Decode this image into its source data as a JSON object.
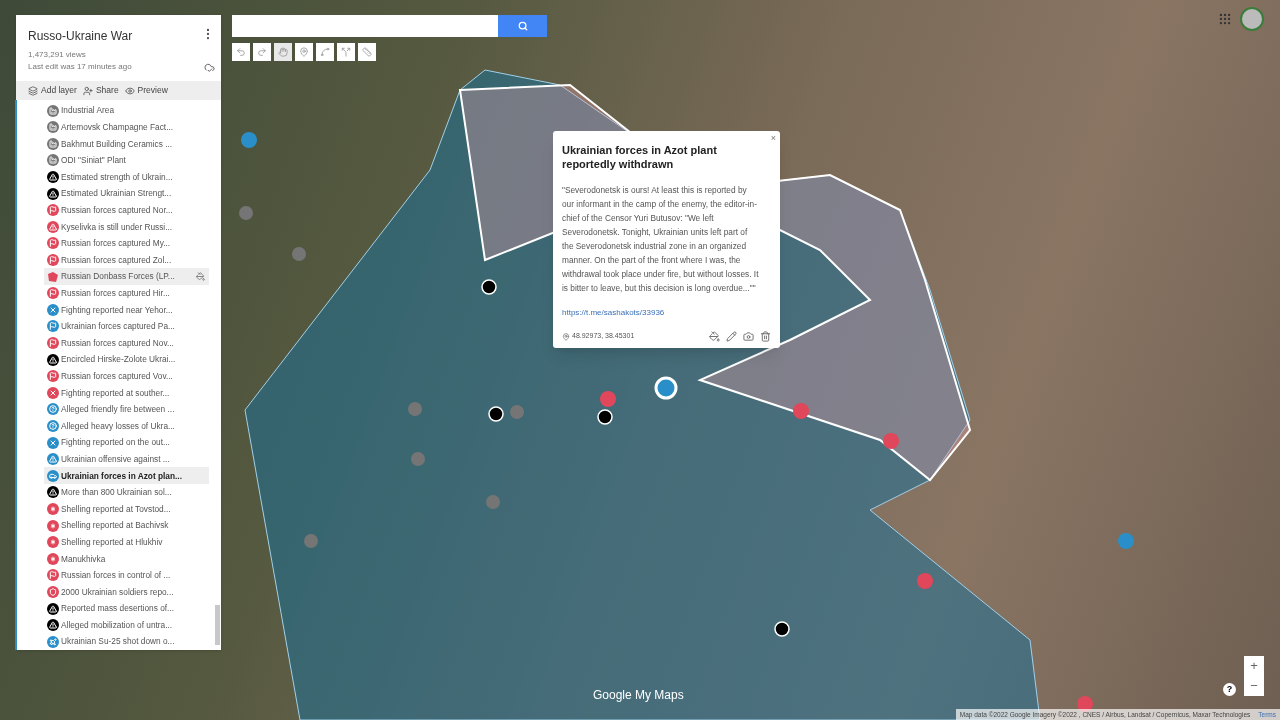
{
  "sidebar": {
    "title": "Russo-Ukraine War",
    "views": "1,473,291 views",
    "last_edit": "Last edit was 17 minutes ago",
    "actions": [
      {
        "kind": "layers",
        "label": "Add layer"
      },
      {
        "kind": "share",
        "label": "Share"
      },
      {
        "kind": "preview",
        "label": "Preview"
      }
    ],
    "items": [
      {
        "label": "Industrial Area",
        "kind": "building",
        "color": "#757575",
        "selected": false,
        "hovered": false
      },
      {
        "label": "Artemovsk Champagne Fact...",
        "kind": "building",
        "color": "#757575",
        "selected": false,
        "hovered": false
      },
      {
        "label": "Bakhmut Building Ceramics ...",
        "kind": "building",
        "color": "#757575",
        "selected": false,
        "hovered": false
      },
      {
        "label": "ODI \"Siniat\" Plant",
        "kind": "building",
        "color": "#757575",
        "selected": false,
        "hovered": false
      },
      {
        "label": "Estimated strength of Ukrain...",
        "kind": "warning",
        "color": "#000000",
        "selected": false,
        "hovered": false
      },
      {
        "label": "Estimated Ukrainian Strengt...",
        "kind": "warning",
        "color": "#000000",
        "selected": false,
        "hovered": false
      },
      {
        "label": "Russian forces captured Nor...",
        "kind": "flag",
        "color": "#e0475b",
        "selected": false,
        "hovered": false
      },
      {
        "label": "Kyselivka is still under Russi...",
        "kind": "warning",
        "color": "#e0475b",
        "selected": false,
        "hovered": false
      },
      {
        "label": "Russian forces captured My...",
        "kind": "flag",
        "color": "#e0475b",
        "selected": false,
        "hovered": false
      },
      {
        "label": "Russian forces captured Zol...",
        "kind": "flag",
        "color": "#e0475b",
        "selected": false,
        "hovered": false
      },
      {
        "label": "Russian Donbass Forces (LP...",
        "kind": "polygon",
        "color": "#e0475b",
        "selected": false,
        "hovered": true
      },
      {
        "label": "Russian forces captured Hir...",
        "kind": "flag",
        "color": "#e0475b",
        "selected": false,
        "hovered": false
      },
      {
        "label": "Fighting reported near Yehor...",
        "kind": "cross",
        "color": "#2a8fc9",
        "selected": false,
        "hovered": false
      },
      {
        "label": "Ukrainian forces captured Pa...",
        "kind": "flag",
        "color": "#2a8fc9",
        "selected": false,
        "hovered": false
      },
      {
        "label": "Russian forces captured Nov...",
        "kind": "flag",
        "color": "#e0475b",
        "selected": false,
        "hovered": false
      },
      {
        "label": "Encircled Hirske-Zolote Ukrai...",
        "kind": "warning",
        "color": "#000000",
        "selected": false,
        "hovered": false
      },
      {
        "label": "Russian forces captured Vov...",
        "kind": "flag",
        "color": "#e0475b",
        "selected": false,
        "hovered": false
      },
      {
        "label": "Fighting reported at souther...",
        "kind": "cross",
        "color": "#e0475b",
        "selected": false,
        "hovered": false
      },
      {
        "label": "Alleged friendly fire between ...",
        "kind": "question",
        "color": "#2a8fc9",
        "selected": false,
        "hovered": false
      },
      {
        "label": "Alleged heavy losses of Ukra...",
        "kind": "question",
        "color": "#2a8fc9",
        "selected": false,
        "hovered": false
      },
      {
        "label": "Fighting reported on the out...",
        "kind": "cross",
        "color": "#2a8fc9",
        "selected": false,
        "hovered": false
      },
      {
        "label": "Ukrainian offensive against ...",
        "kind": "warning",
        "color": "#2a8fc9",
        "selected": false,
        "hovered": false
      },
      {
        "label": "Ukrainian forces in Azot plan...",
        "kind": "car",
        "color": "#2a8fc9",
        "selected": true,
        "hovered": false
      },
      {
        "label": "More than 800 Ukrainian sol...",
        "kind": "warning",
        "color": "#000000",
        "selected": false,
        "hovered": false
      },
      {
        "label": "Shelling reported at Tovstod...",
        "kind": "burst",
        "color": "#e0475b",
        "selected": false,
        "hovered": false
      },
      {
        "label": "Shelling reported at Bachivsk",
        "kind": "burst",
        "color": "#e0475b",
        "selected": false,
        "hovered": false
      },
      {
        "label": "Shelling reported at Hlukhiv",
        "kind": "burst",
        "color": "#e0475b",
        "selected": false,
        "hovered": false
      },
      {
        "label": "Manukhivka",
        "kind": "burst",
        "color": "#e0475b",
        "selected": false,
        "hovered": false
      },
      {
        "label": "Russian forces in control of ...",
        "kind": "flag",
        "color": "#e0475b",
        "selected": false,
        "hovered": false
      },
      {
        "label": "2000 Ukrainian soldiers repo...",
        "kind": "shield",
        "color": "#e0475b",
        "selected": false,
        "hovered": false
      },
      {
        "label": "Reported mass desertions of...",
        "kind": "warning",
        "color": "#000000",
        "selected": false,
        "hovered": false
      },
      {
        "label": "Alleged mobilization of untra...",
        "kind": "warning",
        "color": "#000000",
        "selected": false,
        "hovered": false
      },
      {
        "label": "Ukrainian Su-25 shot down o...",
        "kind": "plane",
        "color": "#2a8fc9",
        "selected": false,
        "hovered": false
      }
    ]
  },
  "popup": {
    "close": "×",
    "title": "Ukrainian forces in Azot plant reportedly withdrawn",
    "body": "\"Severodonetsk is ours! At least this is reported by our informant in the camp of the enemy, the editor-in-chief of the Censor Yuri Butusov: \"We left Severodonetsk. Tonight, Ukrainian units left part of the Severodonetsk industrial zone in an organized manner. On the part of the front where I was, the withdrawal took place under fire, but without losses. It is bitter to leave, but this decision is long overdue...\"\"",
    "link": "https://t.me/sashakots/33936",
    "coordinates": "48.92973, 38.45301"
  },
  "map": {
    "logo": "Google My Maps",
    "attribution": "Map data ©2022 Google Imagery ©2022 , CNES / Airbus, Landsat / Copernicus, Maxar Technologies",
    "terms": "Terms",
    "help": "?",
    "zoom_in": "+",
    "zoom_out": "−"
  }
}
